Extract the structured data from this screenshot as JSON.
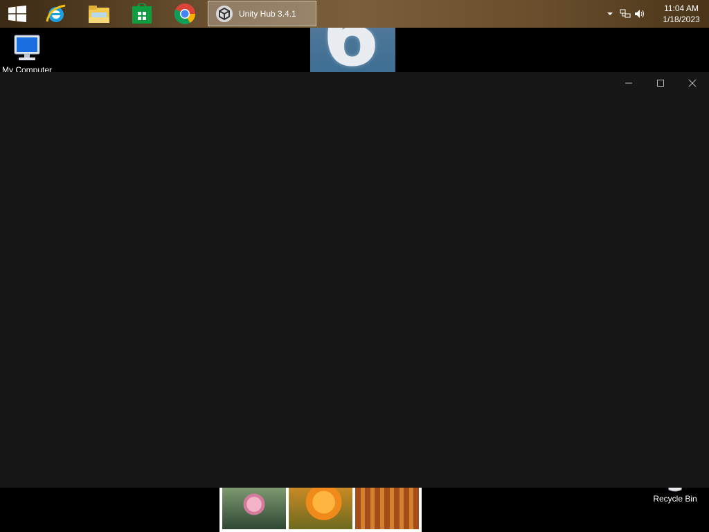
{
  "desktop": {
    "icons": [
      {
        "id": "computer",
        "label": "My Computer"
      },
      {
        "id": "recycle",
        "label": "Recycle Bin"
      }
    ],
    "wallpaper_tile_text": "6"
  },
  "taskbar": {
    "pinned": [
      "Start",
      "Internet Explorer",
      "File Explorer",
      "Store",
      "Google Chrome"
    ],
    "active_window": {
      "title": "Unity Hub 3.4.1"
    },
    "clock": {
      "time": "11:04 AM",
      "date": "1/18/2023"
    }
  },
  "window": {
    "title": "Unity Hub 3.4.1",
    "background": "#161616"
  },
  "colors": {
    "taskbar_accent": "#6b5130",
    "window_bg": "#161616"
  }
}
